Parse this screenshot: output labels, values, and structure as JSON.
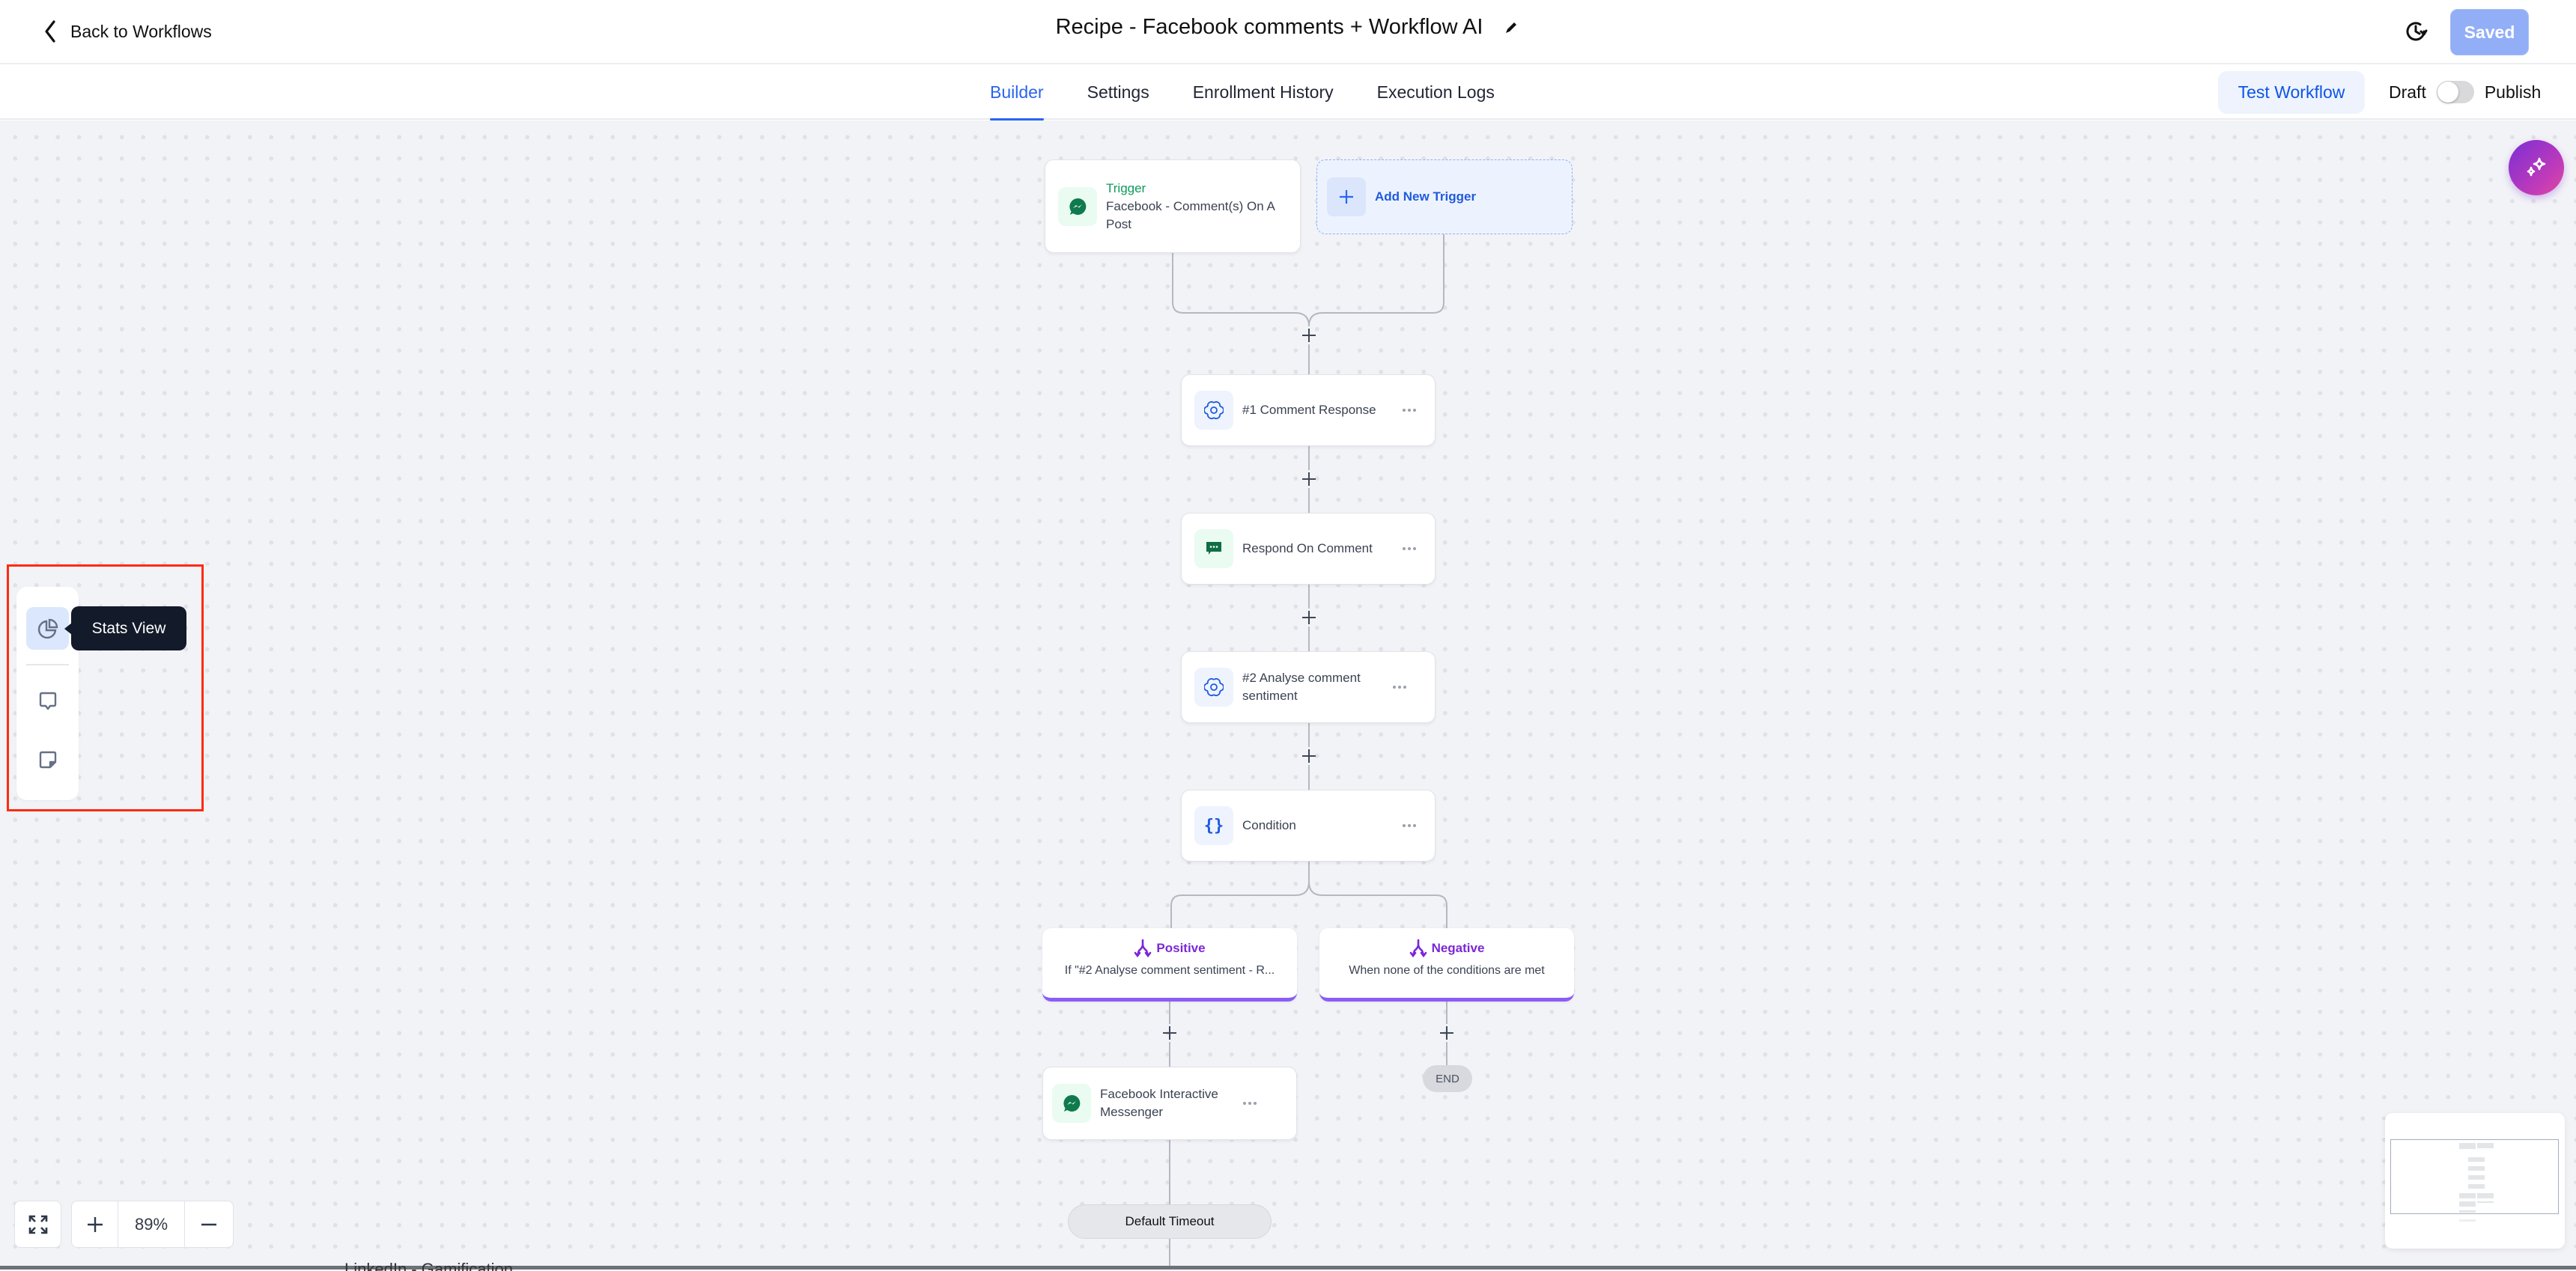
{
  "header": {
    "back_label": "Back to Workflows",
    "title": "Recipe - Facebook comments + Workflow AI",
    "saved_label": "Saved"
  },
  "tabs": [
    {
      "label": "Builder",
      "active": true
    },
    {
      "label": "Settings",
      "active": false
    },
    {
      "label": "Enrollment History",
      "active": false
    },
    {
      "label": "Execution Logs",
      "active": false
    }
  ],
  "actions": {
    "test_workflow_label": "Test Workflow",
    "draft_label": "Draft",
    "publish_label": "Publish",
    "published": false
  },
  "workflow": {
    "trigger": {
      "type_label": "Trigger",
      "name": "Facebook - Comment(s) On A Post",
      "icon": "messenger-icon"
    },
    "add_trigger_label": "Add New Trigger",
    "steps": [
      {
        "name": "#1 Comment Response",
        "icon": "openai-icon"
      },
      {
        "name": "Respond On Comment",
        "icon": "chat-bubble-icon"
      },
      {
        "name": "#2 Analyse comment sentiment",
        "icon": "openai-icon"
      },
      {
        "name": "Condition",
        "icon": "curly-braces-icon"
      }
    ],
    "branches": [
      {
        "name": "Positive",
        "description": "If \"#2 Analyse comment sentiment - R..."
      },
      {
        "name": "Negative",
        "description": "When none of the conditions are met"
      }
    ],
    "positive_step": {
      "name": "Facebook Interactive Messenger",
      "icon": "messenger-icon"
    },
    "end_label": "END",
    "timeout_label": "Default Timeout"
  },
  "side_tools": {
    "items": [
      {
        "name": "stats-view",
        "icon": "pie-chart-icon",
        "active": true
      },
      {
        "name": "comments",
        "icon": "comment-icon",
        "active": false
      },
      {
        "name": "sticky-note",
        "icon": "sticky-note-icon",
        "active": false
      }
    ],
    "tooltip": "Stats View"
  },
  "zoom": {
    "level": "89%"
  },
  "colors": {
    "primary": "#2a64f0",
    "trigger_green": "#0f9a5a",
    "branch_purple": "#7b27d6",
    "saved_button": "#92aef7",
    "highlight_box": "#ff2a10"
  },
  "bottom_ghost_text": "LinkedIn - Gamification"
}
